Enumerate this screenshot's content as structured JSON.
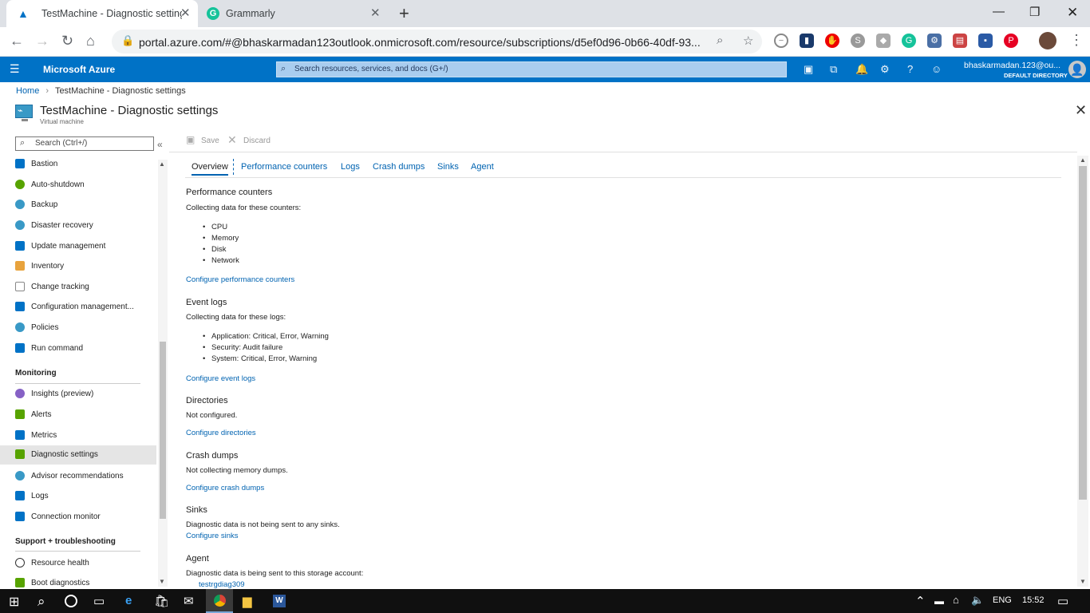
{
  "browser": {
    "tabs": [
      {
        "title": "TestMachine - Diagnostic setting"
      },
      {
        "title": "Grammarly"
      }
    ],
    "new_tab": "+",
    "url": "portal.azure.com/#@bhaskarmadan123outlook.onmicrosoft.com/resource/subscriptions/d5ef0d96-0b66-40df-93..."
  },
  "azure": {
    "brand": "Microsoft Azure",
    "search_placeholder": "Search resources, services, and docs (G+/)",
    "user": "bhaskarmadan.123@ou...",
    "directory": "DEFAULT DIRECTORY"
  },
  "breadcrumb": {
    "home": "Home",
    "current": "TestMachine - Diagnostic settings"
  },
  "blade": {
    "title": "TestMachine - Diagnostic settings",
    "subtitle": "Virtual machine"
  },
  "sidebar": {
    "search_placeholder": "Search (Ctrl+/)",
    "collapse": "«",
    "items_top": [
      {
        "label": "Bastion",
        "color": "#0072c6"
      },
      {
        "label": "Auto-shutdown",
        "color": "#57a300"
      },
      {
        "label": "Backup",
        "color": "#3999c6"
      },
      {
        "label": "Disaster recovery",
        "color": "#3999c6"
      },
      {
        "label": "Update management",
        "color": "#0072c6"
      },
      {
        "label": "Inventory",
        "color": "#e8a33d"
      },
      {
        "label": "Change tracking",
        "color": "#888888"
      },
      {
        "label": "Configuration management...",
        "color": "#0072c6"
      },
      {
        "label": "Policies",
        "color": "#3999c6"
      },
      {
        "label": "Run command",
        "color": "#0072c6"
      }
    ],
    "monitoring_header": "Monitoring",
    "items_monitoring": [
      {
        "label": "Insights (preview)",
        "color": "#8661c5"
      },
      {
        "label": "Alerts",
        "color": "#57a300"
      },
      {
        "label": "Metrics",
        "color": "#0072c6"
      },
      {
        "label": "Diagnostic settings",
        "color": "#57a300"
      },
      {
        "label": "Advisor recommendations",
        "color": "#3999c6"
      },
      {
        "label": "Logs",
        "color": "#0072c6"
      },
      {
        "label": "Connection monitor",
        "color": "#0072c6"
      }
    ],
    "support_header": "Support + troubleshooting",
    "items_support": [
      {
        "label": "Resource health",
        "color": "#333333"
      },
      {
        "label": "Boot diagnostics",
        "color": "#57a300"
      }
    ]
  },
  "commands": {
    "save": "Save",
    "discard": "Discard"
  },
  "tabs": [
    "Overview",
    "Performance counters",
    "Logs",
    "Crash dumps",
    "Sinks",
    "Agent"
  ],
  "content": {
    "perf_title": "Performance counters",
    "perf_desc": "Collecting data for these counters:",
    "perf_items": [
      "CPU",
      "Memory",
      "Disk",
      "Network"
    ],
    "perf_link": "Configure performance counters",
    "event_title": "Event logs",
    "event_desc": "Collecting data for these logs:",
    "event_items": [
      "Application: Critical, Error, Warning",
      "Security: Audit failure",
      "System: Critical, Error, Warning"
    ],
    "event_link": "Configure event logs",
    "dir_title": "Directories",
    "dir_desc": "Not configured.",
    "dir_link": "Configure directories",
    "crash_title": "Crash dumps",
    "crash_desc": "Not collecting memory dumps.",
    "crash_link": "Configure crash dumps",
    "sinks_title": "Sinks",
    "sinks_desc": "Diagnostic data is not being sent to any sinks.",
    "sinks_link": "Configure sinks",
    "agent_title": "Agent",
    "agent_desc": "Diagnostic data is being sent to this storage account:",
    "agent_link": "testrgdiag309"
  },
  "taskbar": {
    "lang": "ENG",
    "time": "15:52"
  }
}
